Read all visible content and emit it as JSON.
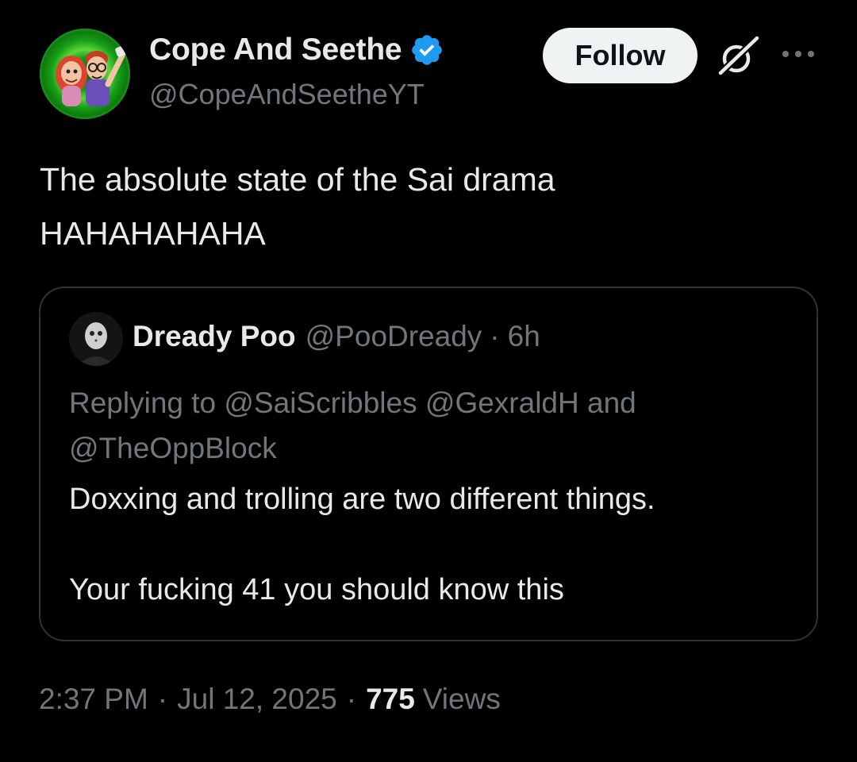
{
  "author": {
    "display_name": "Cope And Seethe",
    "handle": "@CopeAndSeetheYT",
    "verified": true,
    "avatar_icon": "cartoon-duo-avatar"
  },
  "actions": {
    "follow_label": "Follow",
    "grok_icon": "grok-icon",
    "more_icon": "more-icon"
  },
  "tweet": {
    "lines": [
      "The absolute state of the Sai drama",
      "HAHAHAHAHA"
    ]
  },
  "quote": {
    "display_name": "Dready Poo",
    "handle": "@PooDready",
    "separator": "·",
    "time": "6h",
    "replying_line1": "Replying to @SaiScribbles @GexraldH and",
    "replying_line2": "@TheOppBlock",
    "text_line1": "Doxxing and trolling are two different things.",
    "text_line2": "Your fucking 41 you should know this"
  },
  "meta": {
    "time": "2:37 PM",
    "sep1": "·",
    "date": "Jul 12, 2025",
    "sep2": "·",
    "views_count": "775",
    "views_label": "Views"
  },
  "colors": {
    "background": "#000000",
    "text_primary": "#e7e9ea",
    "text_secondary": "#71767b",
    "verified_blue": "#1d9bf0",
    "border": "#2f3336",
    "follow_bg": "#eff3f4"
  }
}
